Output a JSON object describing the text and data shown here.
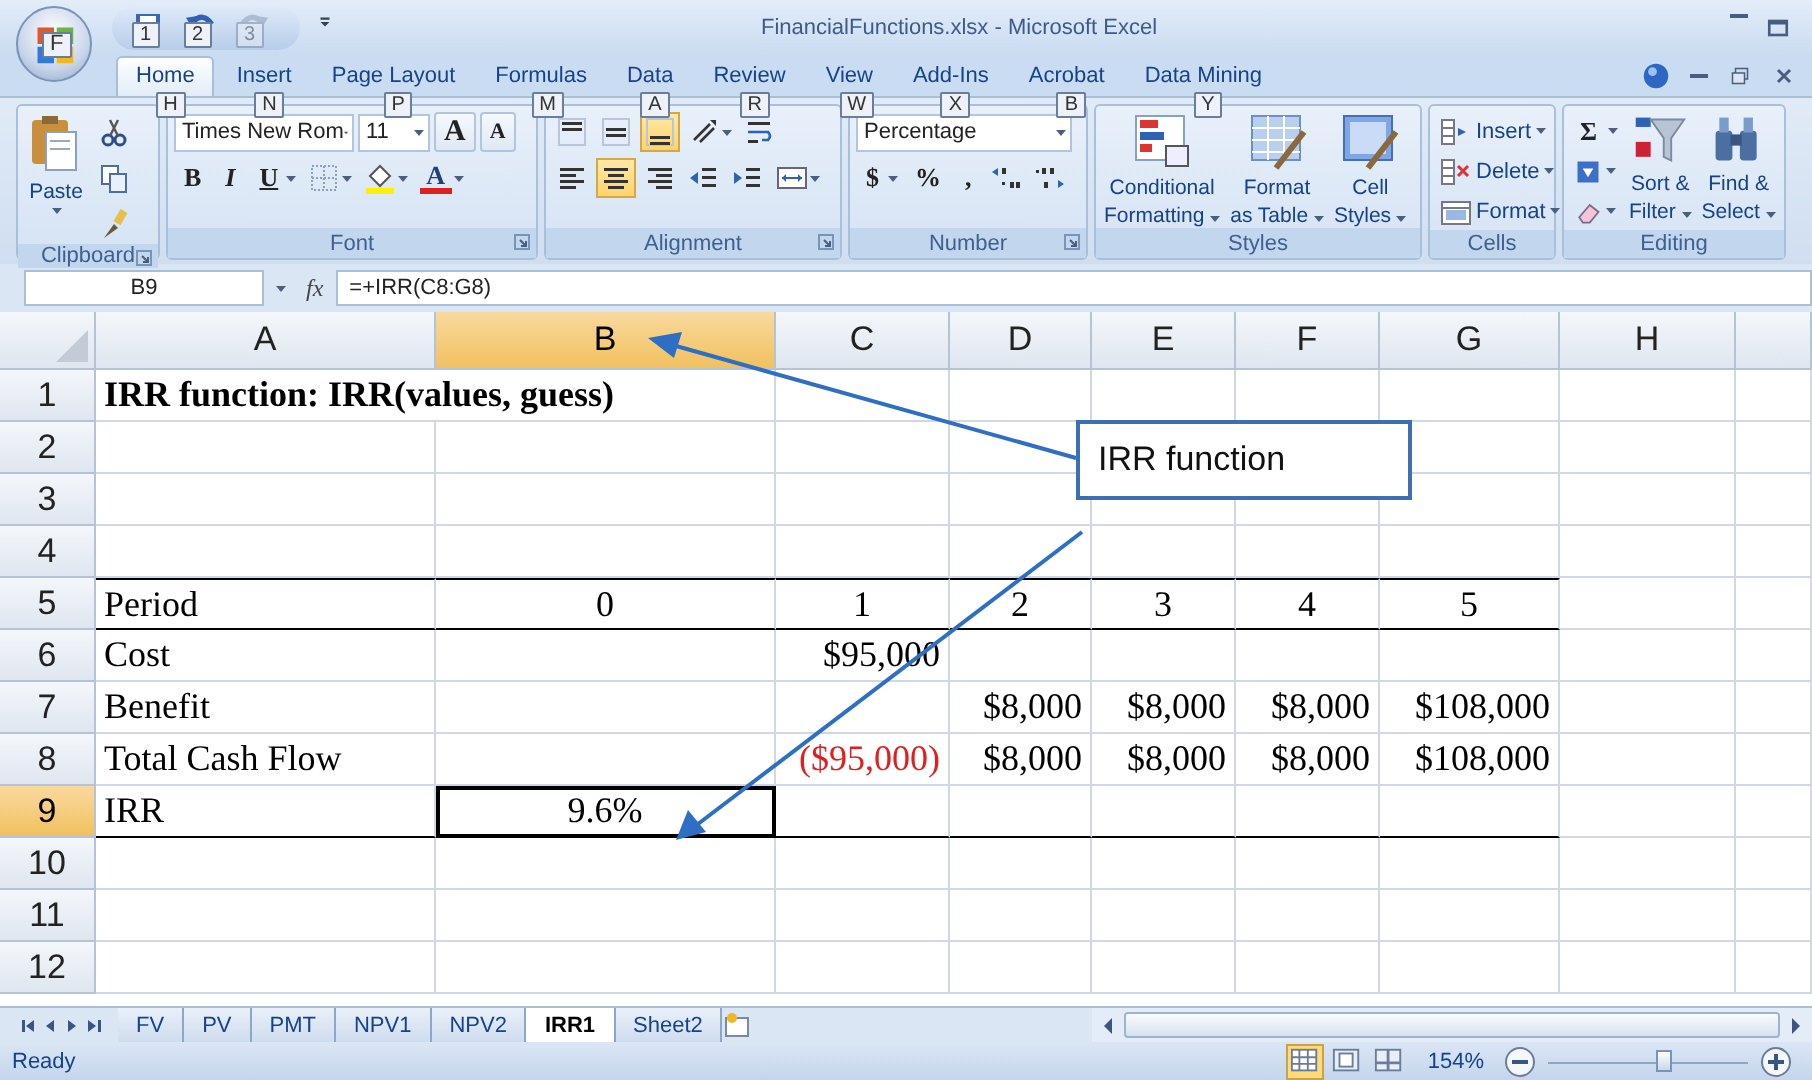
{
  "window": {
    "title": "FinancialFunctions.xlsx - Microsoft Excel"
  },
  "office_button": {
    "key_tip": "F"
  },
  "quick_access": [
    {
      "key_tip": "1",
      "disabled": false
    },
    {
      "key_tip": "2",
      "disabled": false
    },
    {
      "key_tip": "3",
      "disabled": true
    }
  ],
  "ribbon_tabs": [
    {
      "label": "Home",
      "key_tip": "H",
      "selected": true
    },
    {
      "label": "Insert",
      "key_tip": "N",
      "selected": false
    },
    {
      "label": "Page Layout",
      "key_tip": "P",
      "selected": false
    },
    {
      "label": "Formulas",
      "key_tip": "M",
      "selected": false
    },
    {
      "label": "Data",
      "key_tip": "A",
      "selected": false
    },
    {
      "label": "Review",
      "key_tip": "R",
      "selected": false
    },
    {
      "label": "View",
      "key_tip": "W",
      "selected": false
    },
    {
      "label": "Add-Ins",
      "key_tip": "X",
      "selected": false
    },
    {
      "label": "Acrobat",
      "key_tip": "B",
      "selected": false
    },
    {
      "label": "Data Mining",
      "key_tip": "Y",
      "selected": false
    }
  ],
  "ribbon": {
    "clipboard": {
      "label": "Clipboard",
      "paste": "Paste"
    },
    "font": {
      "label": "Font",
      "font_name": "Times New Rom",
      "font_size": "11",
      "size_buttons": [
        "A",
        "A"
      ],
      "style_buttons": [
        "B",
        "I",
        "U"
      ],
      "color_button": "A"
    },
    "alignment": {
      "label": "Alignment",
      "vertical": [
        {
          "selected": false
        },
        {
          "selected": false
        },
        {
          "selected": true
        }
      ],
      "horizontal": [
        {
          "selected": false
        },
        {
          "selected": true
        },
        {
          "selected": false
        }
      ]
    },
    "number": {
      "label": "Number",
      "format": "Percentage",
      "buttons": [
        "$",
        "%",
        ","
      ]
    },
    "styles": {
      "label": "Styles",
      "buttons": [
        {
          "lines": [
            "Conditional",
            "Formatting"
          ]
        },
        {
          "lines": [
            "Format",
            "as Table"
          ]
        },
        {
          "lines": [
            "Cell",
            "Styles"
          ]
        }
      ]
    },
    "cells": {
      "label": "Cells",
      "buttons": [
        "Insert",
        "Delete",
        "Format"
      ]
    },
    "editing": {
      "label": "Editing",
      "autosum": "Σ",
      "buttons": [
        {
          "lines": [
            "Sort &",
            "Filter"
          ]
        },
        {
          "lines": [
            "Find &",
            "Select"
          ]
        }
      ]
    }
  },
  "formula_bar": {
    "name_box": "B9",
    "function_label": "fx",
    "formula": "=+IRR(C8:G8)"
  },
  "sheet": {
    "columns": [
      {
        "label": "A",
        "selected": false
      },
      {
        "label": "B",
        "selected": true
      },
      {
        "label": "C",
        "selected": false
      },
      {
        "label": "D",
        "selected": false
      },
      {
        "label": "E",
        "selected": false
      },
      {
        "label": "F",
        "selected": false
      },
      {
        "label": "G",
        "selected": false
      },
      {
        "label": "H",
        "selected": false
      }
    ],
    "rows": [
      {
        "header": "1",
        "selected": false,
        "rule_above": false,
        "rule_below": false,
        "cells": [
          {
            "text": "IRR function: IRR(values, guess)",
            "kind": "title"
          },
          null,
          null,
          null,
          null,
          null,
          null,
          null
        ]
      },
      {
        "header": "2",
        "selected": false,
        "rule_above": false,
        "rule_below": false,
        "cells": [
          null,
          null,
          null,
          null,
          null,
          null,
          null,
          null
        ]
      },
      {
        "header": "3",
        "selected": false,
        "rule_above": false,
        "rule_below": false,
        "cells": [
          null,
          null,
          null,
          null,
          null,
          null,
          null,
          null
        ]
      },
      {
        "header": "4",
        "selected": false,
        "rule_above": false,
        "rule_below": false,
        "cells": [
          null,
          null,
          null,
          null,
          null,
          null,
          null,
          null
        ]
      },
      {
        "header": "5",
        "selected": false,
        "rule_above": true,
        "rule_below": true,
        "cells": [
          {
            "text": "Period",
            "kind": "label"
          },
          {
            "text": "0",
            "kind": "center"
          },
          {
            "text": "1",
            "kind": "center"
          },
          {
            "text": "2",
            "kind": "center"
          },
          {
            "text": "3",
            "kind": "center"
          },
          {
            "text": "4",
            "kind": "center"
          },
          {
            "text": "5",
            "kind": "center"
          },
          null
        ]
      },
      {
        "header": "6",
        "selected": false,
        "rule_above": false,
        "rule_below": false,
        "cells": [
          {
            "text": "Cost",
            "kind": "label"
          },
          null,
          {
            "text": "$95,000",
            "kind": "number"
          },
          null,
          null,
          null,
          null,
          null
        ]
      },
      {
        "header": "7",
        "selected": false,
        "rule_above": false,
        "rule_below": false,
        "cells": [
          {
            "text": "Benefit",
            "kind": "label"
          },
          null,
          null,
          {
            "text": "$8,000",
            "kind": "number"
          },
          {
            "text": "$8,000",
            "kind": "number"
          },
          {
            "text": "$8,000",
            "kind": "number"
          },
          {
            "text": "$108,000",
            "kind": "number"
          },
          null
        ]
      },
      {
        "header": "8",
        "selected": false,
        "rule_above": false,
        "rule_below": false,
        "cells": [
          {
            "text": "Total Cash Flow",
            "kind": "label"
          },
          null,
          {
            "text": "($95,000)",
            "kind": "negative"
          },
          {
            "text": "$8,000",
            "kind": "number"
          },
          {
            "text": "$8,000",
            "kind": "number"
          },
          {
            "text": "$8,000",
            "kind": "number"
          },
          {
            "text": "$108,000",
            "kind": "number"
          },
          null
        ]
      },
      {
        "header": "9",
        "selected": true,
        "rule_above": false,
        "rule_below": true,
        "cells": [
          {
            "text": "IRR",
            "kind": "label"
          },
          {
            "text": "9.6%",
            "kind": "center"
          },
          null,
          null,
          null,
          null,
          null,
          null
        ]
      },
      {
        "header": "10",
        "selected": false,
        "rule_above": false,
        "rule_below": false,
        "cells": [
          null,
          null,
          null,
          null,
          null,
          null,
          null,
          null
        ]
      },
      {
        "header": "11",
        "selected": false,
        "rule_above": false,
        "rule_below": false,
        "cells": [
          null,
          null,
          null,
          null,
          null,
          null,
          null,
          null
        ]
      },
      {
        "header": "12",
        "selected": false,
        "rule_above": false,
        "rule_below": false,
        "cells": [
          null,
          null,
          null,
          null,
          null,
          null,
          null,
          null
        ]
      }
    ]
  },
  "callout": {
    "text": "IRR function"
  },
  "sheet_tabs": [
    {
      "label": "FV",
      "selected": false
    },
    {
      "label": "PV",
      "selected": false
    },
    {
      "label": "PMT",
      "selected": false
    },
    {
      "label": "NPV1",
      "selected": false
    },
    {
      "label": "NPV2",
      "selected": false
    },
    {
      "label": "IRR1",
      "selected": true
    },
    {
      "label": "Sheet2",
      "selected": false
    }
  ],
  "status_bar": {
    "status": "Ready",
    "view_buttons": [
      {
        "selected": true
      },
      {
        "selected": false
      },
      {
        "selected": false
      }
    ],
    "zoom": "154%",
    "zoom_slider": {
      "level": 0.58
    }
  }
}
